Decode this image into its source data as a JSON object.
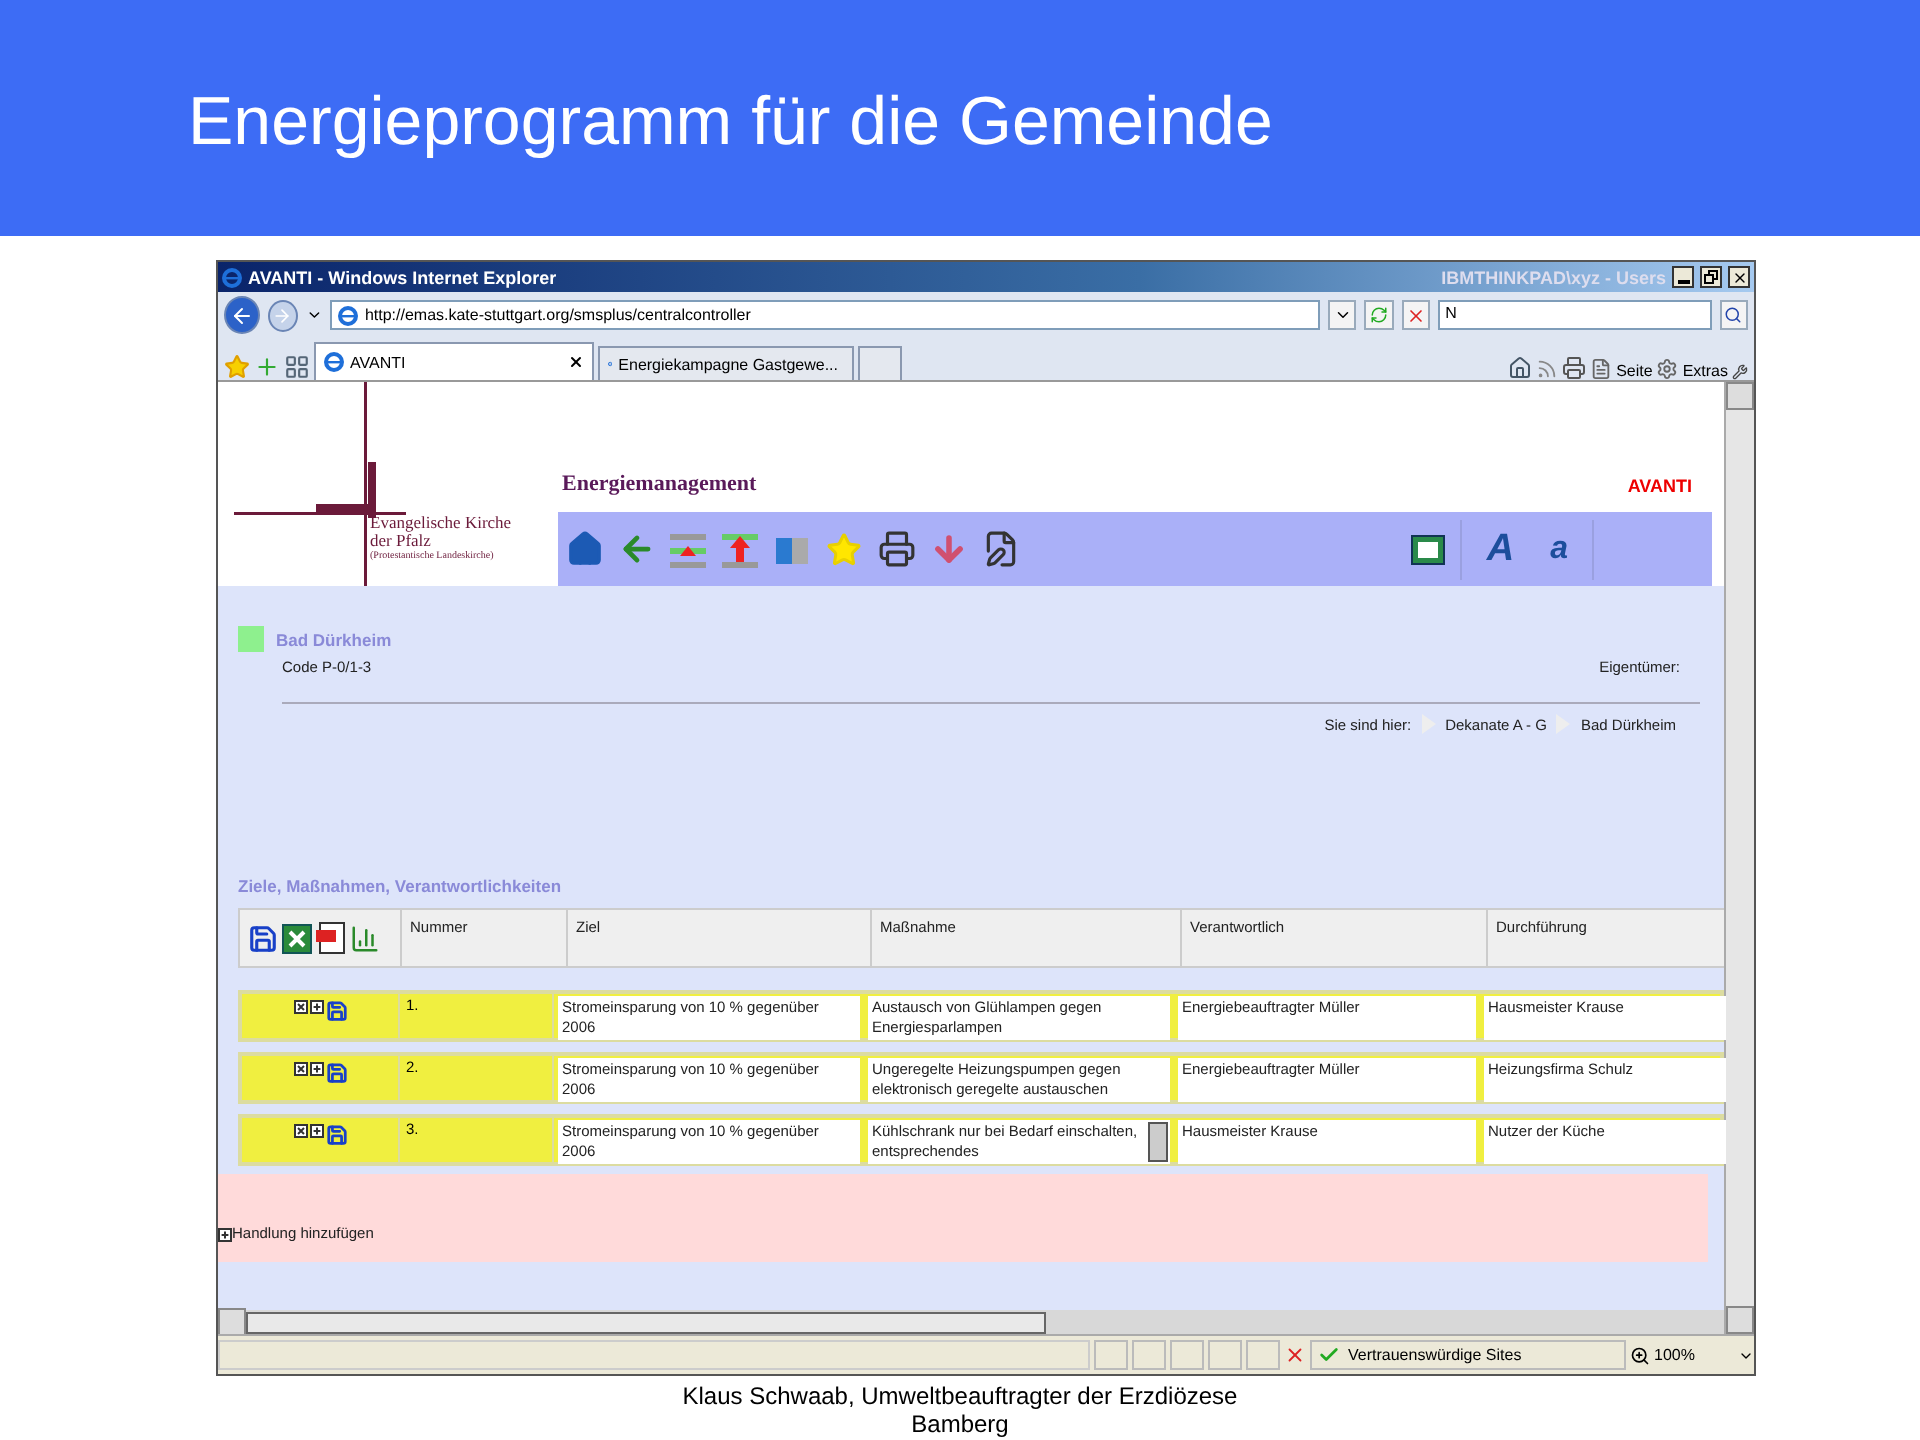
{
  "slide": {
    "title": "Energieprogramm für die Gemeinde",
    "caption": "Klaus Schwaab, Umweltbeauftragter der Erzdiözese Bamberg"
  },
  "browser": {
    "title": "AVANTI - Windows Internet Explorer",
    "user": "IBMTHINKPAD\\xyz - Users",
    "address": "http://emas.kate-stuttgart.org/smsplus/centralcontroller",
    "search": "N",
    "tabs": [
      {
        "label": "AVANTI",
        "selected": true
      },
      {
        "label": "Energiekampagne Gastgewe...",
        "selected": false
      }
    ],
    "commands": [
      "Seite",
      "Extras"
    ],
    "status": {
      "zone": "Vertrauenswürdige Sites",
      "zoom": "100%"
    }
  },
  "app": {
    "logo": [
      "Evangelische Kirche",
      "der Pfalz",
      "(Protestantische Landeskirche)"
    ],
    "module": "Energiemanagement",
    "brand": "AVANTI",
    "font_buttons": [
      "A",
      "a"
    ]
  },
  "object": {
    "name": "Bad Dürkheim",
    "code": "Code P-0/1-3",
    "owner_label": "Eigentümer:",
    "breadcrumb_label": "Sie sind hier:",
    "breadcrumb": [
      "Dekanate A - G",
      "Bad Dürkheim"
    ]
  },
  "section": {
    "title": "Ziele, Maßnahmen, Verantwortlichkeiten",
    "columns": [
      "Nummer",
      "Ziel",
      "Maßnahme",
      "Verantwortlich",
      "Durchführung"
    ],
    "rows": [
      {
        "number": "1.",
        "goal": "Stromeinsparung von 10 % gegenüber 2006",
        "measure": "Austausch von Glühlampen gegen Energiesparlampen",
        "responsible": "Energiebeauftragter Müller",
        "execution": "Hausmeister Krause",
        "scroller": false
      },
      {
        "number": "2.",
        "goal": "Stromeinsparung von 10 % gegenüber 2006",
        "measure": "Ungeregelte Heizungspumpen gegen elektronisch geregelte austauschen",
        "responsible": "Energiebeauftragter Müller",
        "execution": "Heizungsfirma Schulz",
        "scroller": false
      },
      {
        "number": "3.",
        "goal": "Stromeinsparung von 10 % gegenüber 2006",
        "measure": "Kühlschrank nur bei Bedarf einschalten, entsprechendes",
        "responsible": "Hausmeister Krause",
        "execution": "Nutzer der Küche",
        "scroller": true
      }
    ],
    "add_action": "Handlung hinzufügen"
  }
}
